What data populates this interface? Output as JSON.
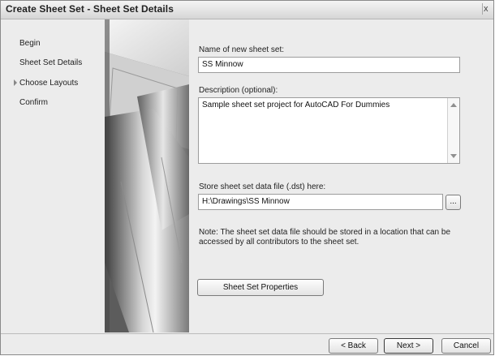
{
  "window": {
    "title": "Create Sheet Set - Sheet Set Details",
    "close_glyph": "x"
  },
  "nav": {
    "items": [
      {
        "label": "Begin"
      },
      {
        "label": "Sheet Set Details",
        "active": true
      },
      {
        "label": "Choose Layouts"
      },
      {
        "label": "Confirm"
      }
    ]
  },
  "form": {
    "name_label": "Name of new sheet set:",
    "name_value": "SS Minnow",
    "description_label": "Description (optional):",
    "description_value": "Sample sheet set project for AutoCAD For Dummies",
    "store_label": "Store sheet set data file (.dst) here:",
    "store_value": "H:\\Drawings\\SS Minnow",
    "browse_label": "...",
    "note": "Note: The sheet set data file should be stored in a location that can be accessed by all contributors to the sheet set.",
    "properties_button": "Sheet Set Properties"
  },
  "footer": {
    "back": "< Back",
    "next": "Next >",
    "cancel": "Cancel"
  },
  "colors": {
    "dialog_bg": "#ececec",
    "field_border": "#9c9c9c"
  },
  "icons": {
    "active_marker": "triangle-right",
    "scroll_up": "triangle-up",
    "scroll_down": "triangle-down"
  }
}
